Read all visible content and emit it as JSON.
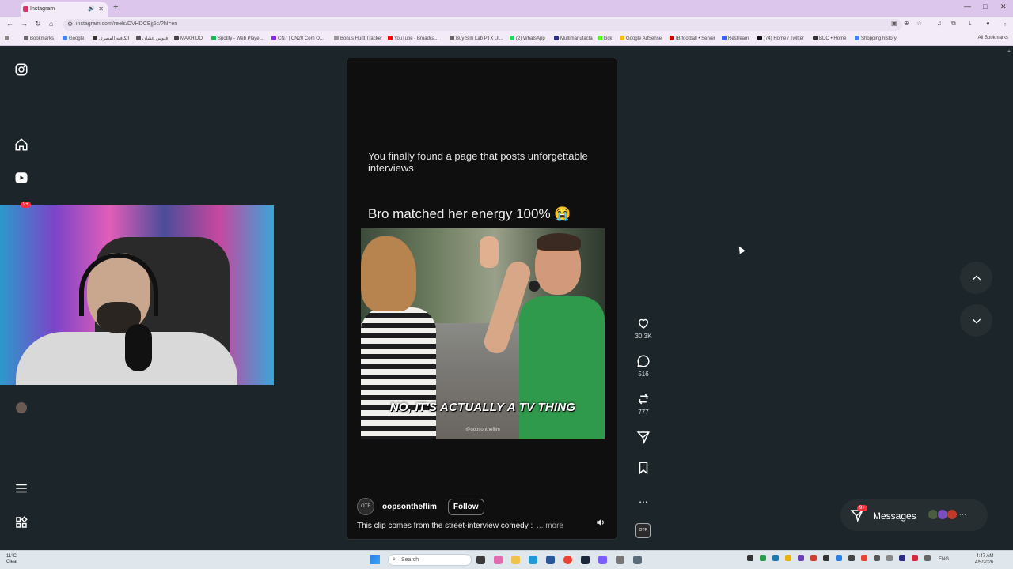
{
  "browser": {
    "tab_title": "Instagram",
    "url": "instagram.com/reels/DVHDCEjj5c/?hl=en",
    "bookmarks": [
      {
        "label": "Bookmarks",
        "color": "#6a6a6a"
      },
      {
        "label": "Google",
        "color": "#4285f4"
      },
      {
        "label": "الكافيه المصري",
        "color": "#333333"
      },
      {
        "label": "فلوس عشان",
        "color": "#555555"
      },
      {
        "label": "MAXHIDO",
        "color": "#444444"
      },
      {
        "label": "Spotify - Web Playe...",
        "color": "#1db954"
      },
      {
        "label": "CN7 | CN20 Com O...",
        "color": "#8a2be2"
      },
      {
        "label": "Bonus Hunt Tracker",
        "color": "#999999"
      },
      {
        "label": "YouTube - Broadca...",
        "color": "#ff0000"
      },
      {
        "label": "Buy Sim Lab PTX Ul...",
        "color": "#666666"
      },
      {
        "label": "(2) WhatsApp",
        "color": "#25d366"
      },
      {
        "label": "Multimanufacta",
        "color": "#2b2b88"
      },
      {
        "label": "kick",
        "color": "#53fc18"
      },
      {
        "label": "Google AdSense",
        "color": "#fbbc04"
      },
      {
        "label": "IB football • Server",
        "color": "#c00"
      },
      {
        "label": "Restream",
        "color": "#3461ff"
      },
      {
        "label": "(74) Home / Twitter",
        "color": "#111111"
      },
      {
        "label": "BDO • Home",
        "color": "#333333"
      },
      {
        "label": "Shopping history",
        "color": "#4285f4"
      }
    ],
    "all_bookmarks": "All Bookmarks"
  },
  "sidebar": {
    "notification_badge": "9+"
  },
  "reel": {
    "caption_top": "You finally found a page that posts unforgettable interviews",
    "caption_main": "Bro matched her energy 100% 😭",
    "subtitle": "NO, IT'S ACTUALLY A TV THING",
    "watermark": "@oopsontheflim",
    "author": "oopsontheflim",
    "avatar_text": "OTF",
    "follow": "Follow",
    "description": "This clip comes from the street-interview comedy :",
    "more": "... more"
  },
  "actions": {
    "likes": "30.3K",
    "comments": "516",
    "reposts": "777",
    "more": "..."
  },
  "messages": {
    "label": "Messages",
    "badge": "9+"
  },
  "taskbar": {
    "weather_temp": "11°C",
    "weather_desc": "Clear",
    "search": "Search",
    "lang": "ENG",
    "time": "4:47 AM",
    "date": "4/5/2026"
  }
}
